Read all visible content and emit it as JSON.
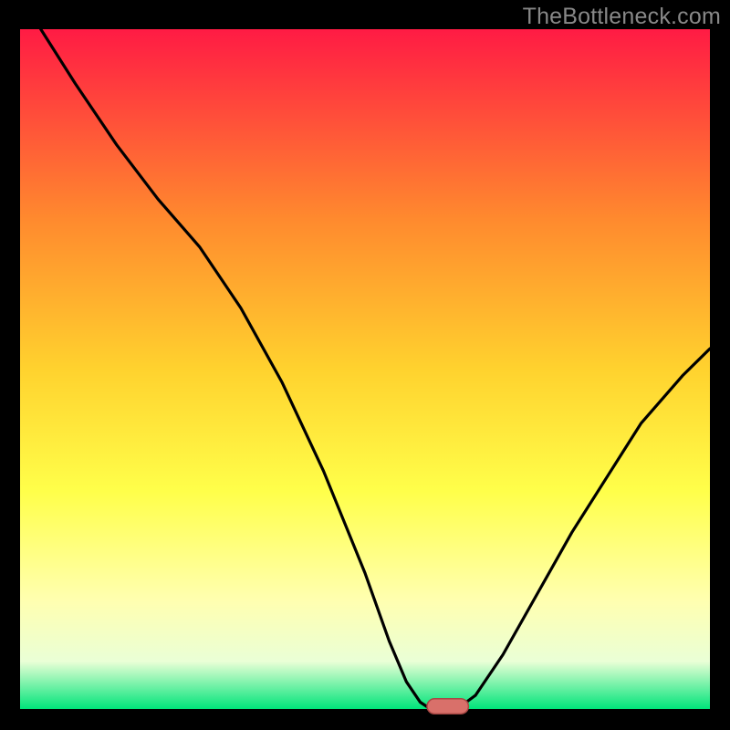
{
  "watermark": "TheBottleneck.com",
  "colors": {
    "black": "#000000",
    "curve": "#000000",
    "marker_fill": "#d9706a",
    "marker_stroke": "#a84744",
    "grad_top": "#ff1b44",
    "grad_mid1": "#ff8a2e",
    "grad_mid2": "#ffd22e",
    "grad_mid3": "#ffff4a",
    "grad_light": "#ffffb0",
    "grad_pale": "#eaffd6",
    "grad_green": "#00e47a"
  },
  "chart_data": {
    "type": "line",
    "title": "",
    "xlabel": "",
    "ylabel": "",
    "xlim": [
      0,
      100
    ],
    "ylim": [
      0,
      100
    ],
    "x": [
      3,
      8,
      14,
      20,
      26,
      32,
      38,
      44,
      50,
      53.5,
      56,
      58,
      59.5,
      61,
      62.5,
      64,
      66,
      70,
      75,
      80,
      85,
      90,
      96,
      100
    ],
    "y": [
      100,
      92,
      83,
      75,
      68,
      59,
      48,
      35,
      20,
      10,
      4,
      1,
      0,
      0,
      0,
      0.5,
      2,
      8,
      17,
      26,
      34,
      42,
      49,
      53
    ],
    "marker": {
      "x_center": 62,
      "y": 0,
      "width": 6,
      "height": 2.2
    },
    "note": "x is percentage across plot width, y is percentage of plot height from bottom (0=bottom, 100=top). Values are estimated from the image; no axis ticks or labels are shown."
  }
}
